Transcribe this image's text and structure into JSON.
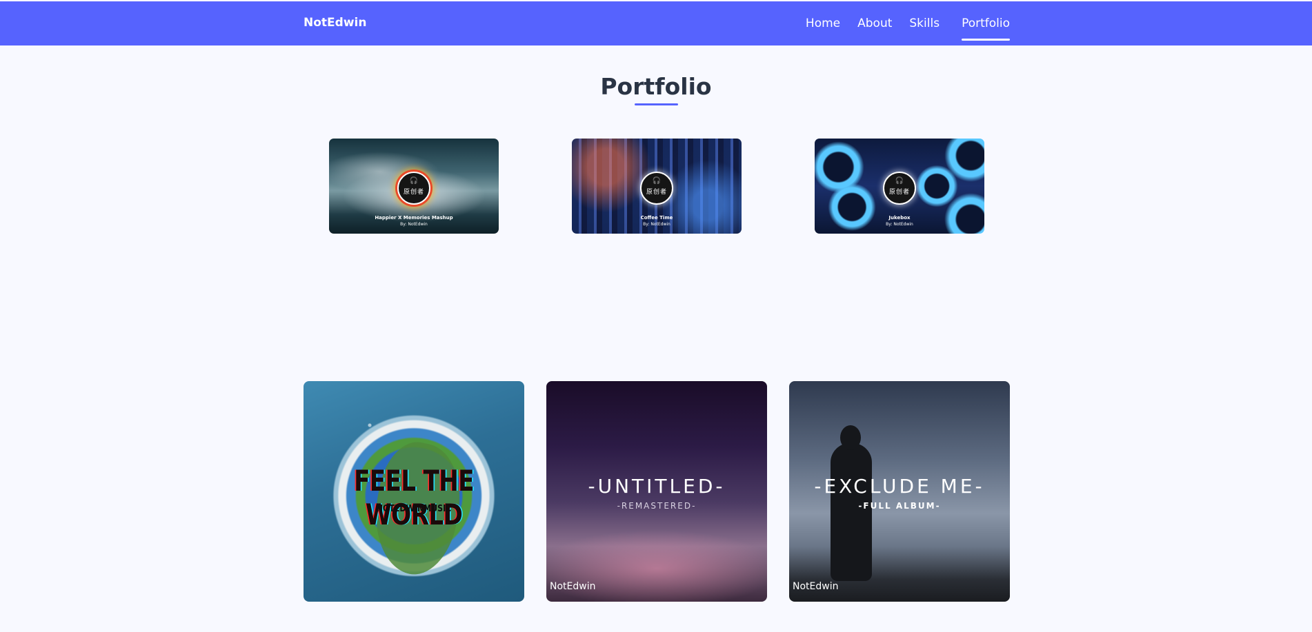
{
  "navbar": {
    "brand": "NotEdwin",
    "links": [
      "Home",
      "About",
      "Skills",
      "Portfolio"
    ],
    "active": "Portfolio",
    "background": "#5663fe"
  },
  "section": {
    "title": "Portfolio",
    "accent": "#5663fe"
  },
  "videos": [
    {
      "title": "Happier X Memories Mashup",
      "by": "By: NotEdwin",
      "badge": "原创者",
      "icon": "headphones-icon"
    },
    {
      "title": "Coffee Time",
      "by": "By: NotEdwin",
      "badge": "原创者",
      "icon": "headphones-icon"
    },
    {
      "title": "Jukebox",
      "by": "By: NotEdwin",
      "badge": "原创者",
      "icon": "headphones-icon"
    }
  ],
  "albums": [
    {
      "title": "FEEL THE WORLD",
      "subtitle": "NOTEDWINMUSIC"
    },
    {
      "title": "-UNTITLED-",
      "subtitle": "-REMASTERED-",
      "credit": "NotEdwin"
    },
    {
      "title": "-EXCLUDE ME-",
      "subtitle": "-FULL ALBUM-",
      "credit": "NotEdwin"
    }
  ]
}
